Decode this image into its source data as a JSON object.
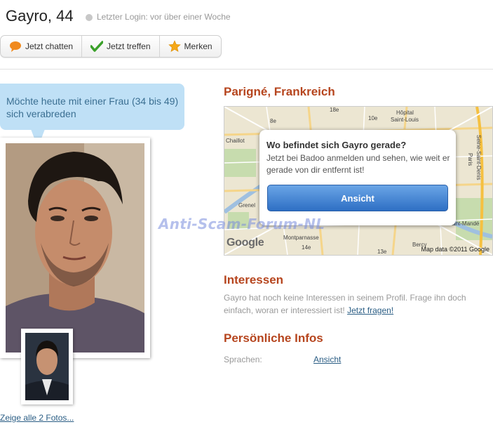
{
  "profile": {
    "name_age": "Gayro, 44",
    "last_login": "Letzter Login: vor über einer Woche"
  },
  "actions": {
    "chat_label": "Jetzt chatten",
    "meet_label": "Jetzt treffen",
    "save_label": "Merken"
  },
  "bubble_text": "Möchte heute mit einer Frau (34 bis 49) sich verabreden",
  "photos": {
    "show_all": "Zeige alle 2 Fotos..."
  },
  "location": {
    "heading": "Parigné, Frankreich",
    "map": {
      "popup_title": "Wo befindet sich Gayro gerade?",
      "popup_text": "Jetzt bei Badoo anmelden und sehen, wie weit er gerade von dir entfernt ist!",
      "popup_button": "Ansicht",
      "copyright": "Map data ©2011 Google",
      "logo": "Google",
      "labels": {
        "l18e": "18e",
        "l10e": "10e",
        "hopital": "Hôpital",
        "saint_louis": "Saint-Louis",
        "chaillot": "Chaillot",
        "l8e": "8e",
        "seine": "Seine-Saint-Denis",
        "paris": "Paris",
        "grenelle": "Grenel",
        "saint_mande": "Saint-Mandé",
        "montparnasse": "Montparnasse",
        "l14e": "14e",
        "l13e": "13e",
        "bercy": "Bercy"
      }
    }
  },
  "interests": {
    "heading": "Interessen",
    "text": "Gayro hat noch keine Interessen in seinem Profil. Frage ihn doch einfach, woran er interessiert ist!",
    "link": "Jetzt fragen!"
  },
  "personal": {
    "heading": "Persönliche Infos",
    "languages_label": "Sprachen:",
    "languages_link": "Ansicht"
  },
  "watermark": "Anti-Scam-Forum-NL"
}
